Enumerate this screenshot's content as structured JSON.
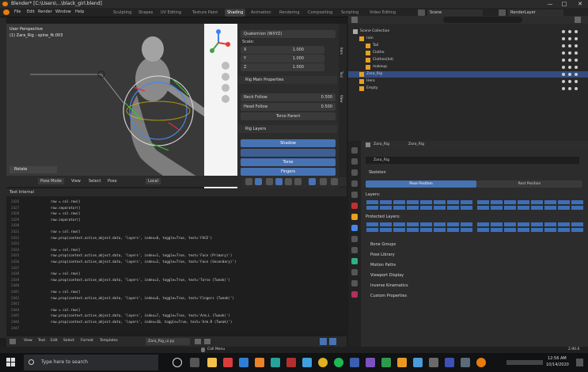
{
  "window": {
    "title": "Blender* [C:\\Users\\...\\black_girl.blend]",
    "minimize_glyph": "—",
    "maximize_glyph": "□",
    "close_glyph": "✕"
  },
  "menu": {
    "items": [
      "File",
      "Edit",
      "Render",
      "Window",
      "Help"
    ]
  },
  "workspaces": {
    "tabs": [
      "Sculpting",
      "Shapes",
      "UV Editing",
      "Texture Paint",
      "Shading",
      "Animation",
      "Rendering",
      "Compositing",
      "Scripting",
      "Video Editing"
    ],
    "active": "Shading"
  },
  "scene": {
    "name": "Scene",
    "view_layer": "RenderLayer"
  },
  "viewport": {
    "perspective": "User Perspective",
    "object_info": "(1) Zara_Rig : spine_fk.003",
    "mode": "Pose Mode",
    "menus": [
      "View",
      "Select",
      "Pose"
    ],
    "transform": "Local",
    "last_op": "Rotate"
  },
  "npanel": {
    "rotation_mode": "Quaternion (WXYZ)",
    "scale_label": "Scale:",
    "scale_rows": [
      {
        "axis": "X",
        "value": "1.000"
      },
      {
        "axis": "Y",
        "value": "1.000"
      },
      {
        "axis": "Z",
        "value": "1.000"
      }
    ],
    "rig_main_title": "Rig Main Properties",
    "rig_rows": [
      {
        "label": "Neck Follow",
        "value": "0.500"
      },
      {
        "label": "Head Follow",
        "value": "0.500"
      }
    ],
    "torso_parent": "Torso Parent",
    "rig_layers_title": "Rig Layers",
    "layer_buttons": [
      "Shadow",
      "",
      "Torso",
      "Fingers"
    ],
    "tabs": [
      "Item",
      "Tool",
      "View"
    ]
  },
  "text_editor": {
    "header": "Text Internal",
    "line_numbers": [
      "2426",
      "2427",
      "2428",
      "2429",
      "2430",
      "2431",
      "2432",
      "2433",
      "2434",
      "2435",
      "2436",
      "2437",
      "2438",
      "2439",
      "2440",
      "2441",
      "2442",
      "2443",
      "2444",
      "2445",
      "2446",
      "2447"
    ],
    "lines": [
      "row = col.row()",
      "row.separator()",
      "row = col.row()",
      "row.separator()",
      "",
      "row = col.row()",
      "row.prop(context.active_object.data, 'layers', index=0, toggle=True, text='FACE')",
      "",
      "row = col.row()",
      "row.prop(context.active_object.data, 'layers', index=1, toggle=True, text='Face (Primary)')",
      "row.prop(context.active_object.data, 'layers', index=2, toggle=True, text='Face (Secondary)')",
      "",
      "row = col.row()",
      "row.prop(context.active_object.data, 'layers', index=3, toggle=True, text='Torso (Tweak)')",
      "",
      "row = col.row()",
      "row.prop(context.active_object.data, 'layers', index=6, toggle=True, text='Fingers (Tweak)')",
      "",
      "row = col.row()",
      "row.prop(context.active_object.data, 'layers', index=7, toggle=True, text='Arm.L (Tweak)')",
      "row.prop(context.active_object.data, 'layers', index=10, toggle=True, text='Arm.R (Tweak)')",
      ""
    ],
    "footer_menus": [
      "View",
      "Text",
      "Edit",
      "Select",
      "Format",
      "Templates"
    ],
    "file_name": "Zara_Rig_ui.py"
  },
  "outliner": {
    "search_placeholder": "",
    "rows": [
      {
        "indent": 0,
        "label": "Scene Collection",
        "selected": false
      },
      {
        "indent": 1,
        "label": "rain",
        "selected": false
      },
      {
        "indent": 2,
        "label": "Tail",
        "selected": false
      },
      {
        "indent": 2,
        "label": "Clothe",
        "selected": false
      },
      {
        "indent": 2,
        "label": "Clothes(hd)",
        "selected": false
      },
      {
        "indent": 2,
        "label": "makeup",
        "selected": false
      },
      {
        "indent": 1,
        "label": "Zara_Rig",
        "selected": true
      },
      {
        "indent": 1,
        "label": "Hero",
        "selected": false
      },
      {
        "indent": 1,
        "label": "Empty",
        "selected": false
      }
    ]
  },
  "properties": {
    "breadcrumb": [
      "Zara_Rig",
      "Zara_Rig"
    ],
    "data_name": "Zara_Rig",
    "skeleton_title": "Skeleton",
    "pose_position": "Pose Position",
    "rest_position": "Rest Position",
    "layers_label": "Layers:",
    "protected_label": "Protected Layers:",
    "sections": [
      "Bone Groups",
      "Pose Library",
      "Motion Paths",
      "Viewport Display",
      "Inverse Kinematics",
      "Custom Properties"
    ]
  },
  "statusbar": {
    "center": "Call Menu",
    "version": "2.90.0"
  },
  "taskbar": {
    "search_placeholder": "Type here to search",
    "time": "12:56 AM",
    "date": "10/14/2020"
  },
  "colors": {
    "accent": "#4772b3",
    "selected_row": "#334d80",
    "bg": "#1d1d1d"
  }
}
